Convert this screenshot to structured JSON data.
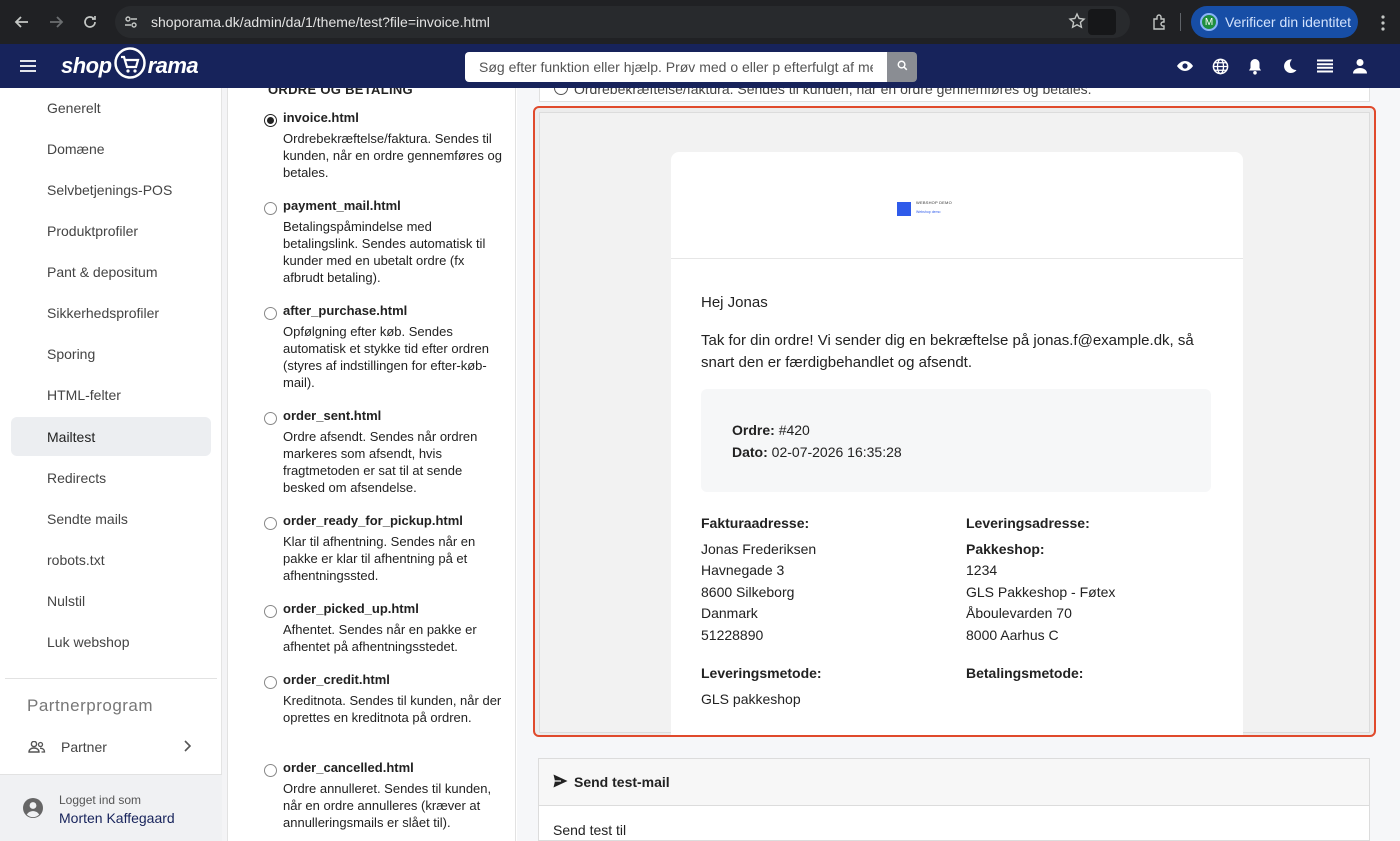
{
  "browser": {
    "url": "shoporama.dk/admin/da/1/theme/test?file=invoice.html",
    "profile_initial": "M",
    "verify_label": "Verificer din identitet"
  },
  "header": {
    "logo_left": "shop",
    "logo_right": "rama",
    "search_placeholder": "Søg efter funktion eller hjælp. Prøv med o eller p efterfulgt af me"
  },
  "sidebar": {
    "items": [
      {
        "label": "Generelt"
      },
      {
        "label": "Domæne"
      },
      {
        "label": "Selvbetjenings-POS"
      },
      {
        "label": "Produktprofiler"
      },
      {
        "label": "Pant & depositum"
      },
      {
        "label": "Sikkerhedsprofiler"
      },
      {
        "label": "Sporing"
      },
      {
        "label": "HTML-felter"
      },
      {
        "label": "Mailtest"
      },
      {
        "label": "Redirects"
      },
      {
        "label": "Sendte mails"
      },
      {
        "label": "robots.txt"
      },
      {
        "label": "Nulstil"
      },
      {
        "label": "Luk webshop"
      }
    ],
    "active_index": 8,
    "partner_title": "Partnerprogram",
    "partner_label": "Partner",
    "logged_in_label": "Logget ind som",
    "user_name": "Morten Kaffegaard"
  },
  "templates": {
    "heading": "ORDRE OG BETALING",
    "items": [
      {
        "name": "invoice.html",
        "desc": "Ordrebekræftelse/faktura. Sendes til kunden, når en ordre gennemføres og betales.",
        "selected": true
      },
      {
        "name": "payment_mail.html",
        "desc": "Betalingspåmindelse med betalingslink. Sendes automatisk til kunder med en ubetalt ordre (fx afbrudt betaling).",
        "selected": false
      },
      {
        "name": "after_purchase.html",
        "desc": "Opfølgning efter køb. Sendes automatisk et stykke tid efter ordren (styres af indstillingen for efter-køb-mail).",
        "selected": false
      },
      {
        "name": "order_sent.html",
        "desc": "Ordre afsendt. Sendes når ordren markeres som afsendt, hvis fragtmetoden er sat til at sende besked om afsendelse.",
        "selected": false
      },
      {
        "name": "order_ready_for_pickup.html",
        "desc": "Klar til afhentning. Sendes når en pakke er klar til afhentning på et afhentningssted.",
        "selected": false
      },
      {
        "name": "order_picked_up.html",
        "desc": "Afhentet. Sendes når en pakke er afhentet på afhentningsstedet.",
        "selected": false
      },
      {
        "name": "order_credit.html",
        "desc": "Kreditnota. Sendes til kunden, når der oprettes en kreditnota på ordren.",
        "selected": false
      },
      {
        "name": "order_cancelled.html",
        "desc": "Ordre annulleret. Sendes til kunden, når en ordre annulleres (kræver at annulleringsmails er slået til).",
        "selected": false
      }
    ]
  },
  "main": {
    "top_text": "Ordrebekræftelse/faktura. Sendes til kunden, når en ordre gennemføres og betales.",
    "email": {
      "logo_line1": "WEBSHOP DEMO",
      "logo_line2": "Webshop demo",
      "greeting": "Hej Jonas",
      "thanks": "Tak for din ordre! Vi sender dig en bekræftelse på jonas.f@example.dk, så snart den er færdigbehandlet og afsendt.",
      "order_label": "Ordre:",
      "order_value": "#420",
      "date_label": "Dato:",
      "date_value": "02-07-2026 16:35:28",
      "billing_heading": "Fakturaadresse:",
      "billing": [
        "Jonas Frederiksen",
        "Havnegade 3",
        "8600 Silkeborg",
        "Danmark",
        "51228890"
      ],
      "shipping_heading": "Leveringsadresse:",
      "shipping_sub": "Pakkeshop:",
      "shipping": [
        "1234",
        "GLS Pakkeshop - Føtex",
        "Åboulevarden 70",
        "8000 Aarhus C"
      ],
      "delivery_heading": "Leveringsmetode:",
      "delivery_value": "GLS pakkeshop",
      "payment_heading": "Betalingsmetode:"
    },
    "send_title": "Send test-mail",
    "send_to_label": "Send test til"
  },
  "colors": {
    "header_bg": "#17235b",
    "highlight_border": "#e04a2c",
    "logo_blue": "#2f5bea"
  }
}
